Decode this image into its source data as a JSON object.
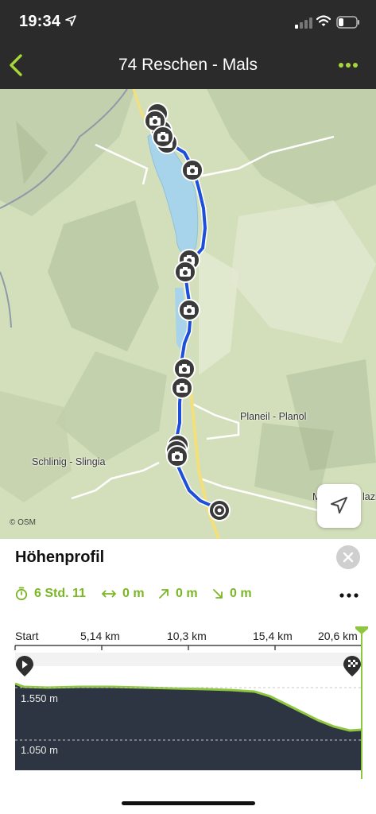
{
  "status_bar": {
    "time": "19:34"
  },
  "header": {
    "title": "74 Reschen - Mals"
  },
  "map": {
    "labels": {
      "planeil": "Planeil - Planol",
      "schlinig": "Schlinig - Slingia",
      "mals_partial": "Ma",
      "mals_partial_right": "lazi"
    },
    "attribution": "© OSM",
    "start_marker": "A",
    "photo_marker_count": 13
  },
  "sheet": {
    "title": "Höhenprofil",
    "stats": {
      "duration": "6 Std. 11",
      "distance": "0 m",
      "ascent": "0 m",
      "descent": "0 m"
    }
  },
  "profile": {
    "x_ticks": [
      "Start",
      "5,14 km",
      "10,3 km",
      "15,4 km",
      "20,6 km"
    ],
    "y_labels": [
      "1.550 m",
      "1.050 m"
    ]
  },
  "colors": {
    "accent": "#7ab625",
    "route": "#1d4fd8",
    "lake": "#a7d4ea",
    "profile_bg": "#2c3541"
  }
}
